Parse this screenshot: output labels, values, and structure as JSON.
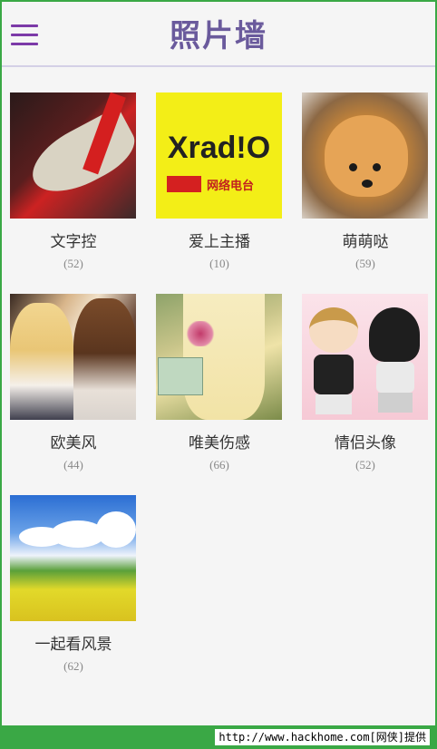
{
  "header": {
    "title": "照片墙"
  },
  "albums": [
    {
      "name": "文字控",
      "count": "(52)",
      "thumb": "high-heel-shoe-photo"
    },
    {
      "name": "爱上主播",
      "count": "(10)",
      "thumb": "xradio-logo",
      "logo_text": "Xrad!O",
      "logo_sub": "网络电台"
    },
    {
      "name": "萌萌哒",
      "count": "(59)",
      "thumb": "pomeranian-dog-photo"
    },
    {
      "name": "欧美风",
      "count": "(44)",
      "thumb": "two-girls-photo"
    },
    {
      "name": "唯美伤感",
      "count": "(66)",
      "thumb": "dress-flowers-photo"
    },
    {
      "name": "情侣头像",
      "count": "(52)",
      "thumb": "cartoon-couple-image"
    },
    {
      "name": "一起看风景",
      "count": "(62)",
      "thumb": "landscape-field-photo"
    }
  ],
  "watermark": "http://www.hackhome.com[网侠]提供",
  "colors": {
    "accent": "#7c3aa8",
    "title": "#6a5a9c",
    "frame": "#3aa845",
    "background": "#f5f5f5"
  }
}
